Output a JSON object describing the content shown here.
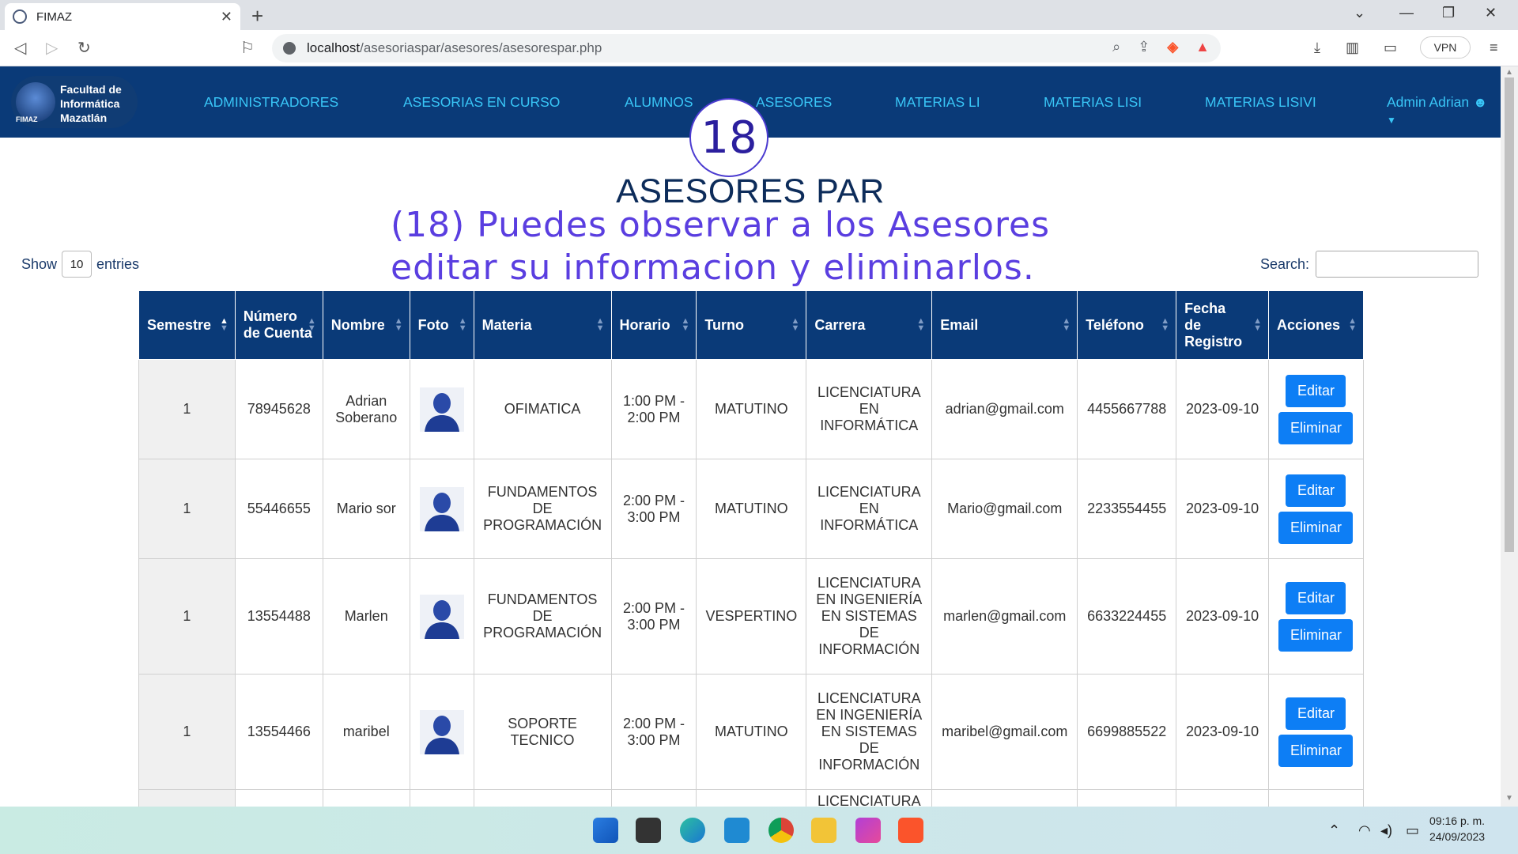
{
  "browser": {
    "tab_title": "FIMAZ",
    "url_host": "localhost",
    "url_path": "/asesoriaspar/asesores/asesorespar.php",
    "vpn_label": "VPN"
  },
  "site": {
    "logo_text": [
      "Facultad de",
      "Informática",
      "Mazatlán"
    ],
    "logo_short": "FIMAZ",
    "nav": [
      "ADMINISTRADORES",
      "ASESORIAS EN CURSO",
      "ALUMNOS",
      "ASESORES",
      "MATERIAS LI",
      "MATERIAS LISI",
      "MATERIAS LISIVI"
    ],
    "user": "Admin Adrian"
  },
  "annotation": {
    "badge": "18",
    "line1": "(18) Puedes observar a los Asesores",
    "line2": "editar su informacion y eliminarlos."
  },
  "page_title": "ASESORES PAR",
  "controls": {
    "show_label": "Show",
    "entries_value": "10",
    "entries_label": "entries",
    "search_label": "Search:"
  },
  "table": {
    "headers": [
      "Semestre",
      "Número de Cuenta",
      "Nombre",
      "Foto",
      "Materia",
      "Horario",
      "Turno",
      "Carrera",
      "Email",
      "Teléfono",
      "Fecha de Registro",
      "Acciones"
    ],
    "edit_label": "Editar",
    "delete_label": "Eliminar",
    "rows": [
      {
        "semestre": "1",
        "cuenta": "78945628",
        "nombre": "Adrian Soberano",
        "materia": "OFIMATICA",
        "horario": "1:00 PM - 2:00 PM",
        "turno": "MATUTINO",
        "carrera": "LICENCIATURA EN INFORMÁTICA",
        "email": "adrian@gmail.com",
        "telefono": "4455667788",
        "fecha": "2023-09-10"
      },
      {
        "semestre": "1",
        "cuenta": "55446655",
        "nombre": "Mario sor",
        "materia": "FUNDAMENTOS DE PROGRAMACIÓN",
        "horario": "2:00 PM - 3:00 PM",
        "turno": "MATUTINO",
        "carrera": "LICENCIATURA EN INFORMÁTICA",
        "email": "Mario@gmail.com",
        "telefono": "2233554455",
        "fecha": "2023-09-10"
      },
      {
        "semestre": "1",
        "cuenta": "13554488",
        "nombre": "Marlen",
        "materia": "FUNDAMENTOS DE PROGRAMACIÓN",
        "horario": "2:00 PM - 3:00 PM",
        "turno": "VESPERTINO",
        "carrera": "LICENCIATURA EN INGENIERÍA EN SISTEMAS DE INFORMACIÓN",
        "email": "marlen@gmail.com",
        "telefono": "6633224455",
        "fecha": "2023-09-10"
      },
      {
        "semestre": "1",
        "cuenta": "13554466",
        "nombre": "maribel",
        "materia": "SOPORTE TECNICO",
        "horario": "2:00 PM - 3:00 PM",
        "turno": "MATUTINO",
        "carrera": "LICENCIATURA EN INGENIERÍA EN SISTEMAS DE INFORMACIÓN",
        "email": "maribel@gmail.com",
        "telefono": "6699885522",
        "fecha": "2023-09-10"
      },
      {
        "semestre": "",
        "cuenta": "",
        "nombre": "",
        "materia": "",
        "horario": "",
        "turno": "",
        "carrera": "LICENCIATURA",
        "email": "",
        "telefono": "",
        "fecha": ""
      }
    ]
  },
  "taskbar": {
    "time": "09:16 p. m.",
    "date": "24/09/2023"
  },
  "colors": {
    "nav_bg": "#0a3a78",
    "nav_text": "#39c6f7",
    "button": "#0d7ef5",
    "annotation": "#5a3ee0"
  }
}
